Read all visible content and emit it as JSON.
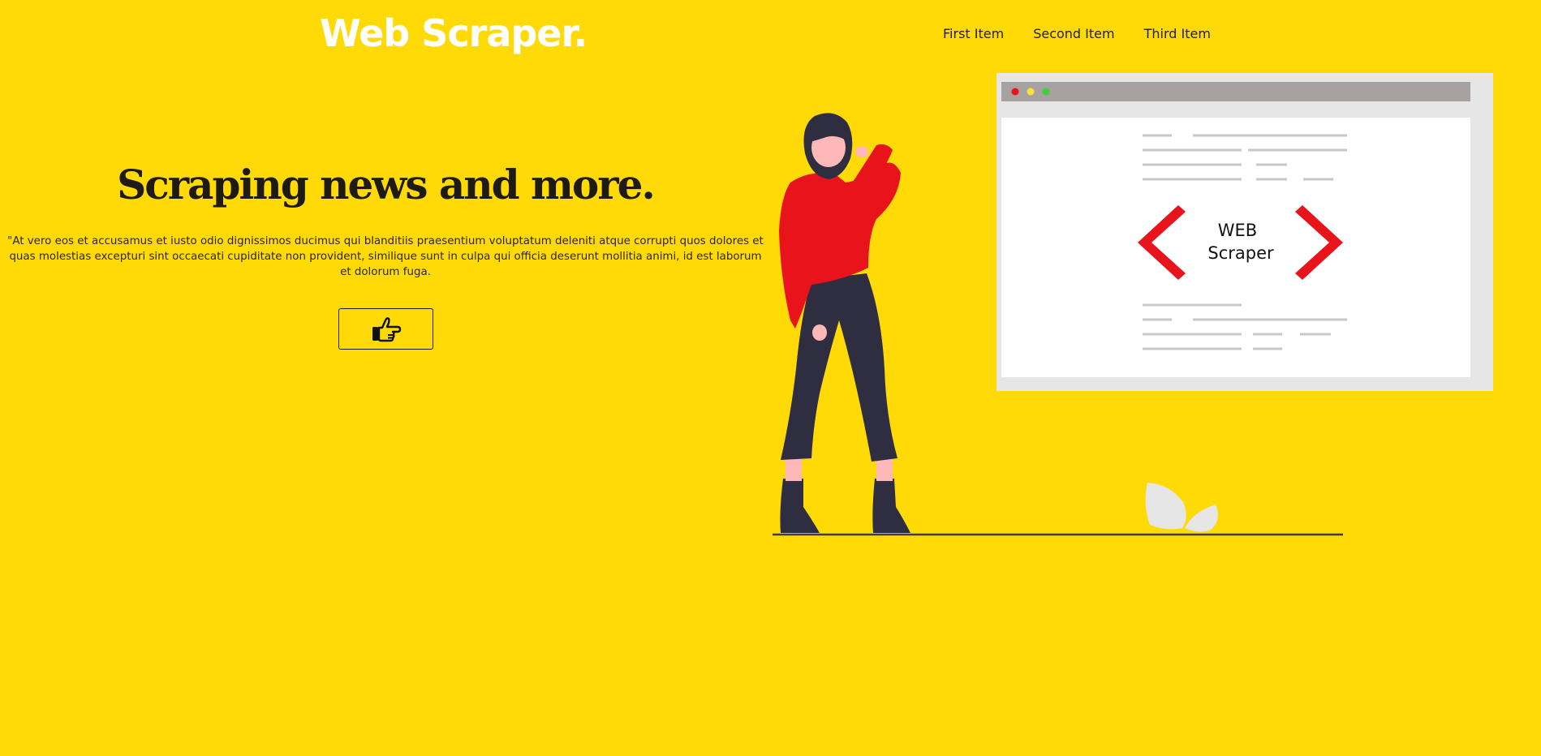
{
  "header": {
    "logo": "Web Scraper.",
    "nav": [
      {
        "label": "First Item"
      },
      {
        "label": "Second Item"
      },
      {
        "label": "Third Item"
      }
    ]
  },
  "hero": {
    "title": "Scraping news and more.",
    "description": "\"At vero eos et accusamus et iusto odio dignissimos ducimus qui blanditiis praesentium voluptatum deleniti atque corrupti quos dolores et quas molestias excepturi sint occaecati cupiditate non provident, similique sunt in culpa qui officia deserunt mollitia animi, id est laborum et dolorum fuga.",
    "cta_icon": "pointing-hand-icon"
  },
  "illustration": {
    "browser_label_line1": "WEB",
    "browser_label_line2": "Scraper"
  },
  "colors": {
    "background": "#FFDA07",
    "logo": "#FFFFFF",
    "accent_red": "#E8131B",
    "figure_dark": "#2F2E41",
    "skin": "#FFB8B8",
    "browser_frame": "#E6E6E6",
    "browser_bar": "#A8A1A1"
  }
}
